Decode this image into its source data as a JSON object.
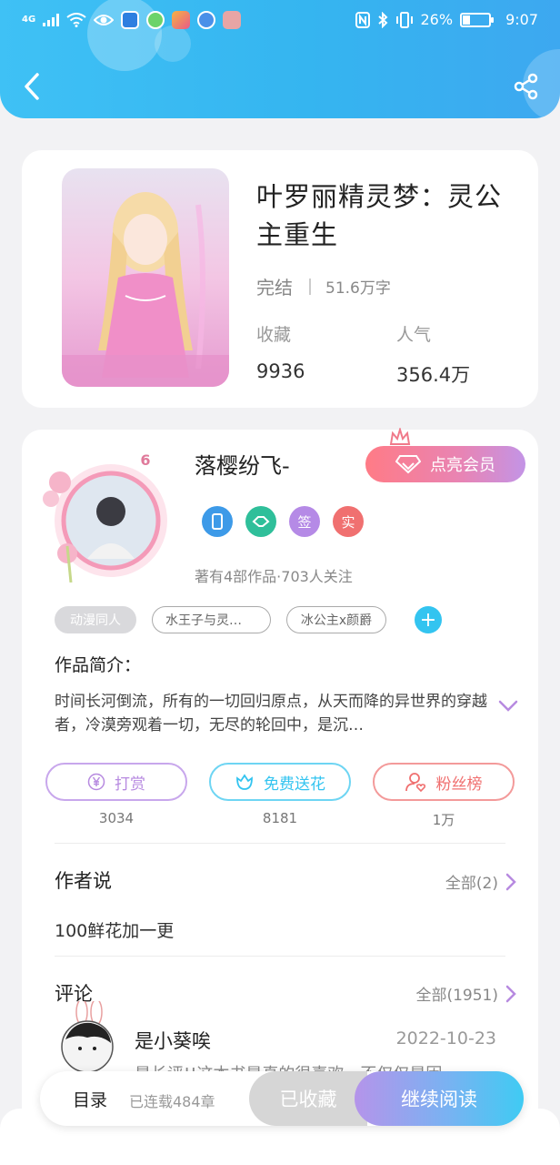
{
  "status_bar": {
    "signal": "4G",
    "battery": "26%",
    "time": "9:07"
  },
  "colors": {
    "header_blue": "#3fc1f5",
    "accent_purple": "#b78ae0",
    "accent_cyan": "#33c4f0",
    "accent_red": "#f06b6b"
  },
  "book": {
    "title": "叶罗丽精灵梦：灵公主重生",
    "status": "完结",
    "word_count": "51.6万字",
    "stats": [
      {
        "label": "收藏",
        "value": "9936"
      },
      {
        "label": "人气",
        "value": "356.4万"
      }
    ]
  },
  "author": {
    "name": "落樱纷飞-",
    "level_badge": "6",
    "vip_button": "点亮会员",
    "badges": [
      {
        "icon": "phone-badge-icon",
        "text": "",
        "color": "#3d9ae8"
      },
      {
        "icon": "handshake-badge-icon",
        "text": "",
        "color": "#2fbf9a"
      },
      {
        "icon": "",
        "text": "签",
        "color": "#b58ae6"
      },
      {
        "icon": "",
        "text": "实",
        "color": "#f07070"
      }
    ],
    "meta": "著有4部作品·703人关注"
  },
  "tags": [
    "动漫同人",
    "水王子与灵…",
    "冰公主x颜爵"
  ],
  "intro": {
    "label": "作品简介：",
    "text": "时间长河倒流，所有的一切回归原点，从天而降的异世界的穿越者，冷漠旁观着一切，无尽的轮回中，是沉…"
  },
  "actions": [
    {
      "label": "打赏",
      "count": "3034",
      "icon": "yen-coin-icon",
      "color": "#b78ae0"
    },
    {
      "label": "免费送花",
      "count": "8181",
      "icon": "flower-icon",
      "color": "#33c4f0"
    },
    {
      "label": "粉丝榜",
      "count": "1万",
      "icon": "fans-icon",
      "color": "#f07070"
    }
  ],
  "author_said": {
    "title": "作者说",
    "more": "全部(2)",
    "content": "100鲜花加一更"
  },
  "comments": {
    "title": "评论",
    "more": "全部(1951)",
    "items": [
      {
        "user": "是小葵唉",
        "date": "2022-10-23",
        "text": "是长评!!这本书是真的很喜欢，不仅仅是因"
      }
    ]
  },
  "bottom_bar": {
    "toc": "目录",
    "toc_sub": "已连载484章",
    "favorited": "已收藏",
    "continue": "继续阅读"
  }
}
